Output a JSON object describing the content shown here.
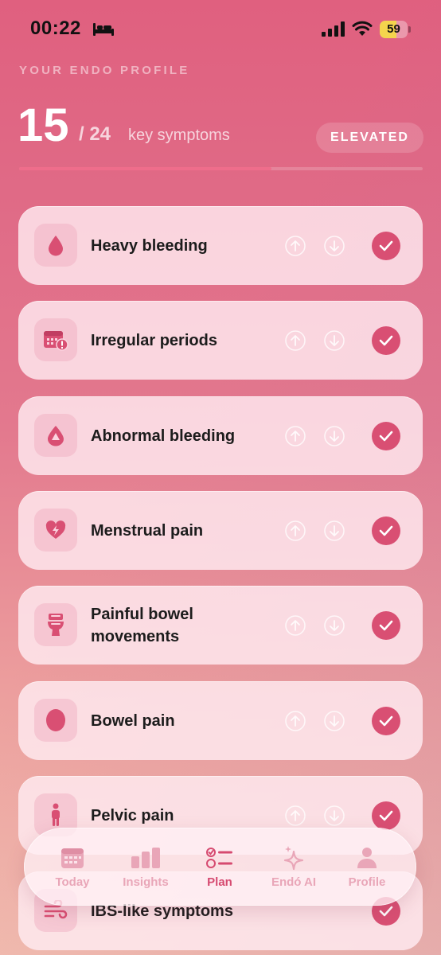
{
  "status_bar": {
    "time": "00:22",
    "battery": "59",
    "battery_level": 0.59
  },
  "header": {
    "eyebrow": "YOUR ENDO PROFILE",
    "count": "15",
    "total": "/ 24",
    "count_label": "key symptoms",
    "level_badge": "ELEVATED",
    "progress": 0.625
  },
  "symptoms": [
    {
      "label": "Heavy bleeding",
      "icon": "drop-icon",
      "checked": true
    },
    {
      "label": "Irregular periods",
      "icon": "calendar-alert-icon",
      "checked": true
    },
    {
      "label": "Abnormal bleeding",
      "icon": "drop-alert-icon",
      "checked": true
    },
    {
      "label": "Menstrual pain",
      "icon": "heart-bolt-icon",
      "checked": true
    },
    {
      "label": "Painful bowel movements",
      "icon": "toilet-icon",
      "checked": true
    },
    {
      "label": "Bowel pain",
      "icon": "oval-icon",
      "checked": true
    },
    {
      "label": "Pelvic pain",
      "icon": "person-icon",
      "checked": true
    },
    {
      "label": "IBS-like symptoms",
      "icon": "wind-icon",
      "checked": true
    }
  ],
  "tab_bar": {
    "tabs": [
      {
        "label": "Today",
        "icon": "calendar-icon"
      },
      {
        "label": "Insights",
        "icon": "bar-chart-icon"
      },
      {
        "label": "Plan",
        "icon": "checklist-icon",
        "active": true
      },
      {
        "label": "Endó AI",
        "icon": "sparkle-icon"
      },
      {
        "label": "Profile",
        "icon": "person-icon"
      }
    ]
  },
  "colors": {
    "accent": "#d94f73",
    "tab_inactive": "#e9a6b8",
    "badge_fill": "#f4d44d"
  }
}
